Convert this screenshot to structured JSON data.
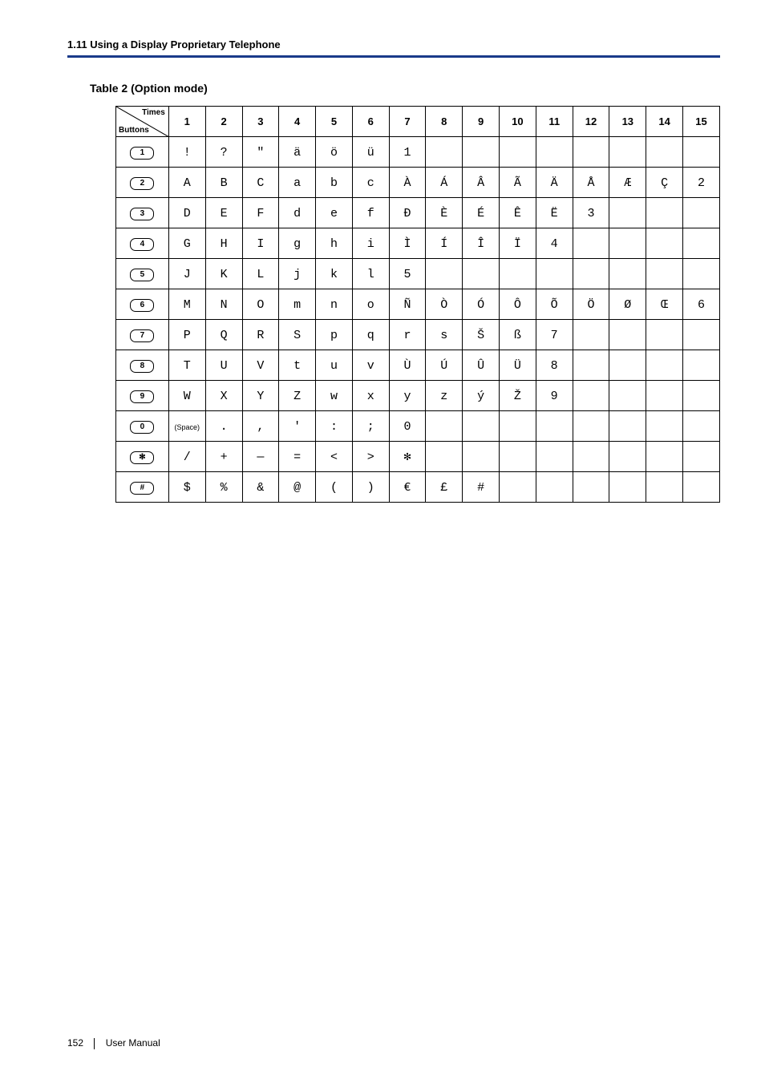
{
  "header": {
    "section": "1.11 Using a Display Proprietary Telephone"
  },
  "table": {
    "title": "Table 2 (Option mode)",
    "corner": {
      "topRight": "Times",
      "bottomLeft": "Buttons"
    },
    "columns": [
      "1",
      "2",
      "3",
      "4",
      "5",
      "6",
      "7",
      "8",
      "9",
      "10",
      "11",
      "12",
      "13",
      "14",
      "15"
    ],
    "rows": [
      {
        "key": "1",
        "cells": [
          "!",
          "?",
          "\"",
          "ä",
          "ö",
          "ü",
          "1",
          "",
          "",
          "",
          "",
          "",
          "",
          "",
          ""
        ]
      },
      {
        "key": "2",
        "cells": [
          "A",
          "B",
          "C",
          "a",
          "b",
          "c",
          "À",
          "Á",
          "Â",
          "Ã",
          "Ä",
          "Å",
          "Æ",
          "Ç",
          "2"
        ]
      },
      {
        "key": "3",
        "cells": [
          "D",
          "E",
          "F",
          "d",
          "e",
          "f",
          "Ð",
          "È",
          "É",
          "Ê",
          "Ë",
          "3",
          "",
          "",
          ""
        ]
      },
      {
        "key": "4",
        "cells": [
          "G",
          "H",
          "I",
          "g",
          "h",
          "i",
          "Ì",
          "Í",
          "Î",
          "Ï",
          "4",
          "",
          "",
          "",
          ""
        ]
      },
      {
        "key": "5",
        "cells": [
          "J",
          "K",
          "L",
          "j",
          "k",
          "l",
          "5",
          "",
          "",
          "",
          "",
          "",
          "",
          "",
          ""
        ]
      },
      {
        "key": "6",
        "cells": [
          "M",
          "N",
          "O",
          "m",
          "n",
          "o",
          "Ñ",
          "Ò",
          "Ó",
          "Ô",
          "Õ",
          "Ö",
          "Ø",
          "Œ",
          "6"
        ]
      },
      {
        "key": "7",
        "cells": [
          "P",
          "Q",
          "R",
          "S",
          "p",
          "q",
          "r",
          "s",
          "Š",
          "ß",
          "7",
          "",
          "",
          "",
          ""
        ]
      },
      {
        "key": "8",
        "cells": [
          "T",
          "U",
          "V",
          "t",
          "u",
          "v",
          "Ù",
          "Ú",
          "Û",
          "Ü",
          "8",
          "",
          "",
          "",
          ""
        ]
      },
      {
        "key": "9",
        "cells": [
          "W",
          "X",
          "Y",
          "Z",
          "w",
          "x",
          "y",
          "z",
          "ý",
          "Ž",
          "9",
          "",
          "",
          "",
          ""
        ]
      },
      {
        "key": "0",
        "cells": [
          "(Space)",
          ".",
          ",",
          "'",
          ":",
          ";",
          "0",
          "",
          "",
          "",
          "",
          "",
          "",
          "",
          ""
        ]
      },
      {
        "key": "✻",
        "cells": [
          "/",
          "+",
          "—",
          "=",
          "<",
          ">",
          "✻",
          "",
          "",
          "",
          "",
          "",
          "",
          "",
          ""
        ]
      },
      {
        "key": "#",
        "cells": [
          "$",
          "%",
          "&",
          "@",
          "(",
          ")",
          "€",
          "£",
          "#",
          "",
          "",
          "",
          "",
          "",
          ""
        ]
      }
    ]
  },
  "footer": {
    "page": "152",
    "label": "User Manual"
  }
}
